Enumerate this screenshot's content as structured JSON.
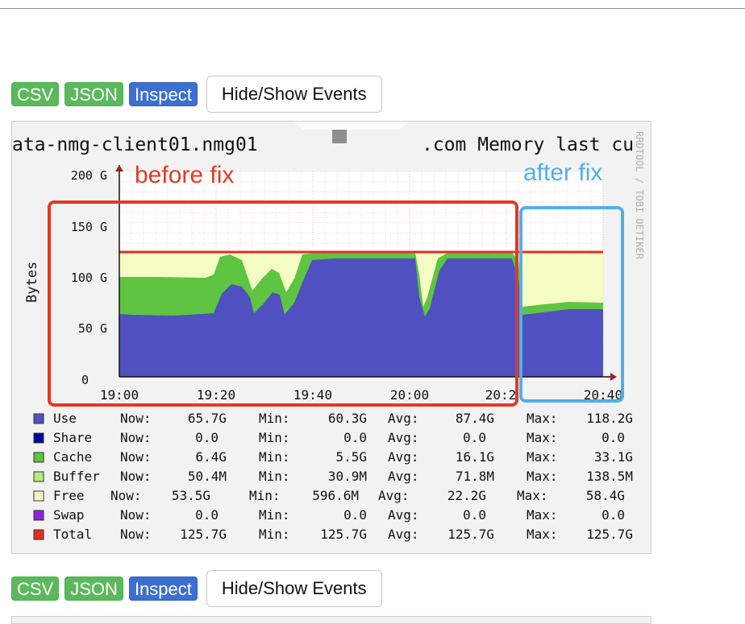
{
  "toolbar": {
    "csv_label": "CSV",
    "json_label": "JSON",
    "inspect_label": "Inspect",
    "events_label": "Hide/Show Events"
  },
  "graph": {
    "title_left": "ata-nmg-client01.nmg01",
    "title_right": ".com Memory last cu",
    "watermark": "RRDTOOL / TOBI OETIKER",
    "ylabel": "Bytes",
    "yticks": [
      "200 G",
      "150 G",
      "100 G",
      "50 G",
      "0"
    ],
    "xticks": [
      "19:00",
      "19:20",
      "19:40",
      "20:00",
      "20:2",
      "20:40"
    ],
    "annotation_before": "before fix",
    "annotation_after": "after fix",
    "colors": {
      "use": "#5050c0",
      "share": "#0000a0",
      "cache": "#5ec442",
      "buffer": "#b4ec80",
      "free": "#f4fcc4",
      "swap": "#9020e0",
      "total": "#e03020",
      "before_box": "#e03a26",
      "after_box": "#4db0ec"
    }
  },
  "legend": {
    "headers": {
      "now": "Now:",
      "min": "Min:",
      "avg": "Avg:",
      "max": "Max:"
    },
    "rows": [
      {
        "name": "Use",
        "color": "#5050c0",
        "now": "65.7G",
        "min": "60.3G",
        "avg": "87.4G",
        "max": "118.2G"
      },
      {
        "name": "Share",
        "color": "#0000a0",
        "now": "0.0",
        "min": "0.0",
        "avg": "0.0",
        "max": "0.0"
      },
      {
        "name": "Cache",
        "color": "#5ec442",
        "now": "6.4G",
        "min": "5.5G",
        "avg": "16.1G",
        "max": "33.1G"
      },
      {
        "name": "Buffer",
        "color": "#b4ec80",
        "now": "50.4M",
        "min": "30.9M",
        "avg": "71.8M",
        "max": "138.5M"
      },
      {
        "name": "Free",
        "color": "#f4fcc4",
        "now": "53.5G",
        "min": "596.6M",
        "avg": "22.2G",
        "max": "58.4G"
      },
      {
        "name": "Swap",
        "color": "#9020e0",
        "now": "0.0",
        "min": "0.0",
        "avg": "0.0",
        "max": "0.0"
      },
      {
        "name": "Total",
        "color": "#e03020",
        "now": "125.7G",
        "min": "125.7G",
        "avg": "125.7G",
        "max": "125.7G"
      }
    ]
  }
}
